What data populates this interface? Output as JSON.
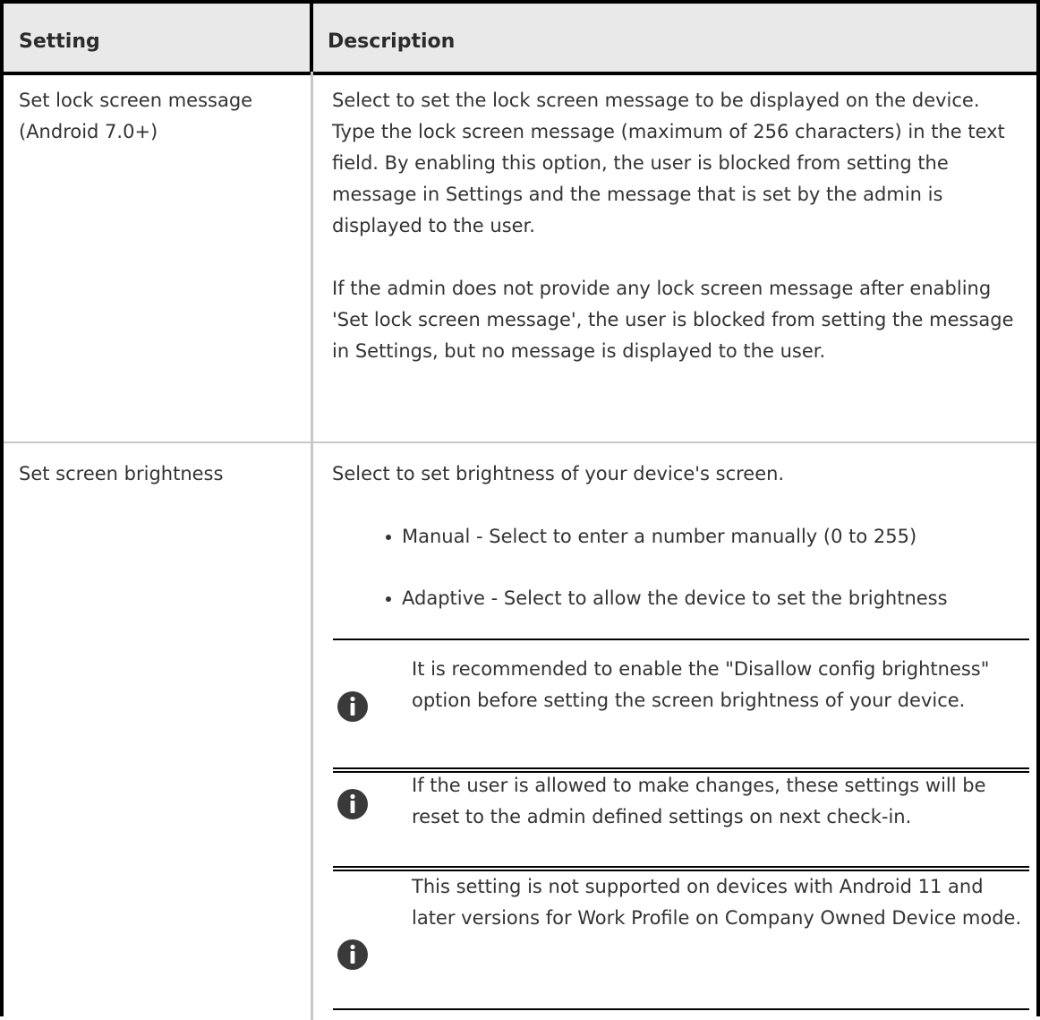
{
  "table": {
    "headers": {
      "setting": "Setting",
      "description": "Description"
    },
    "rows": [
      {
        "setting": "Set lock screen message (Android 7.0+)",
        "paragraphs": [
          "Select to set the lock screen message to be displayed on the device. Type the lock screen message (maximum of 256 characters) in the text field. By enabling this option, the user is blocked from setting the message in Settings and the message that is set by the admin is displayed to the user.",
          "If the admin does not provide any lock screen message after enabling 'Set lock screen message', the user is blocked from setting the message in Settings, but no message is displayed to the user."
        ]
      },
      {
        "setting": "Set screen brightness",
        "intro": "Select to set brightness of your device's screen.",
        "bullets": [
          "Manual - Select to enter a number manually (0 to 255)",
          "Adaptive - Select to allow the device to set the brightness"
        ],
        "notes": [
          "It is recommended to enable the \"Disallow config brightness\" option before setting the screen brightness of your device.",
          "If the user is allowed to make changes, these settings will be reset to the admin defined settings on next check-in.",
          "This setting is not supported on devices with Android 11 and later versions for Work Profile on Company Owned Device mode."
        ]
      }
    ]
  },
  "icons": {
    "note": "info-icon"
  },
  "colors": {
    "header_bg": "#e9e9e9",
    "text": "#333333",
    "border": "#000000",
    "divider": "#c8c8c8",
    "icon_bg": "#3a3a3a"
  }
}
